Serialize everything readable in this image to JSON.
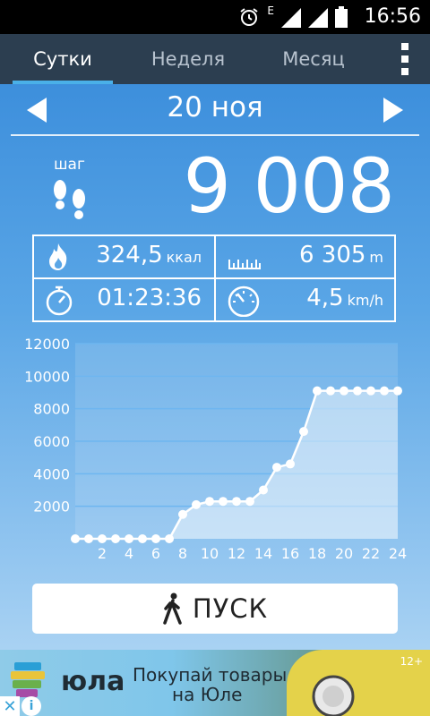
{
  "status_bar": {
    "time": "16:56",
    "network_label": "E"
  },
  "tabs": [
    {
      "label": "Сутки",
      "active": true
    },
    {
      "label": "Неделя",
      "active": false
    },
    {
      "label": "Месяц",
      "active": false
    }
  ],
  "date": "20 ноя",
  "steps": {
    "label": "шаг",
    "value": "9 008"
  },
  "stats": {
    "calories": {
      "value": "324,5",
      "unit": "ккал",
      "icon": "flame-icon"
    },
    "distance": {
      "value": "6 305",
      "unit": "m",
      "icon": "ruler-icon"
    },
    "duration": {
      "value": "01:23:36",
      "icon": "stopwatch-icon"
    },
    "speed": {
      "value": "4,5",
      "unit": "km/h",
      "icon": "speedometer-icon"
    }
  },
  "chart_data": {
    "type": "area",
    "x": [
      0,
      1,
      2,
      3,
      4,
      5,
      6,
      7,
      8,
      9,
      10,
      11,
      12,
      13,
      14,
      15,
      16,
      17,
      18,
      19,
      20,
      21,
      22,
      23,
      24
    ],
    "values": [
      0,
      0,
      0,
      0,
      0,
      0,
      0,
      0,
      1500,
      2100,
      2300,
      2300,
      2300,
      2300,
      3000,
      4400,
      4600,
      6600,
      9100,
      9100,
      9100,
      9100,
      9100,
      9100,
      9100
    ],
    "x_ticks": [
      "2",
      "4",
      "6",
      "8",
      "10",
      "12",
      "14",
      "16",
      "18",
      "20",
      "22",
      "24"
    ],
    "y_ticks": [
      "2000",
      "4000",
      "6000",
      "8000",
      "10000",
      "12000"
    ],
    "ylim": [
      0,
      12000
    ],
    "xlim": [
      0,
      24
    ],
    "grid": true,
    "colors": {
      "line": "#ffffff",
      "fill": "rgba(255,255,255,0.45)",
      "grid": "#6eb6f0"
    }
  },
  "start_button": {
    "label": "ПУСК",
    "icon": "walking-person-icon"
  },
  "ad": {
    "brand": "юла",
    "slogan_line1": "Покупай товары",
    "slogan_line2": "на Юле",
    "age_rating": "12+",
    "info_label": "i"
  }
}
